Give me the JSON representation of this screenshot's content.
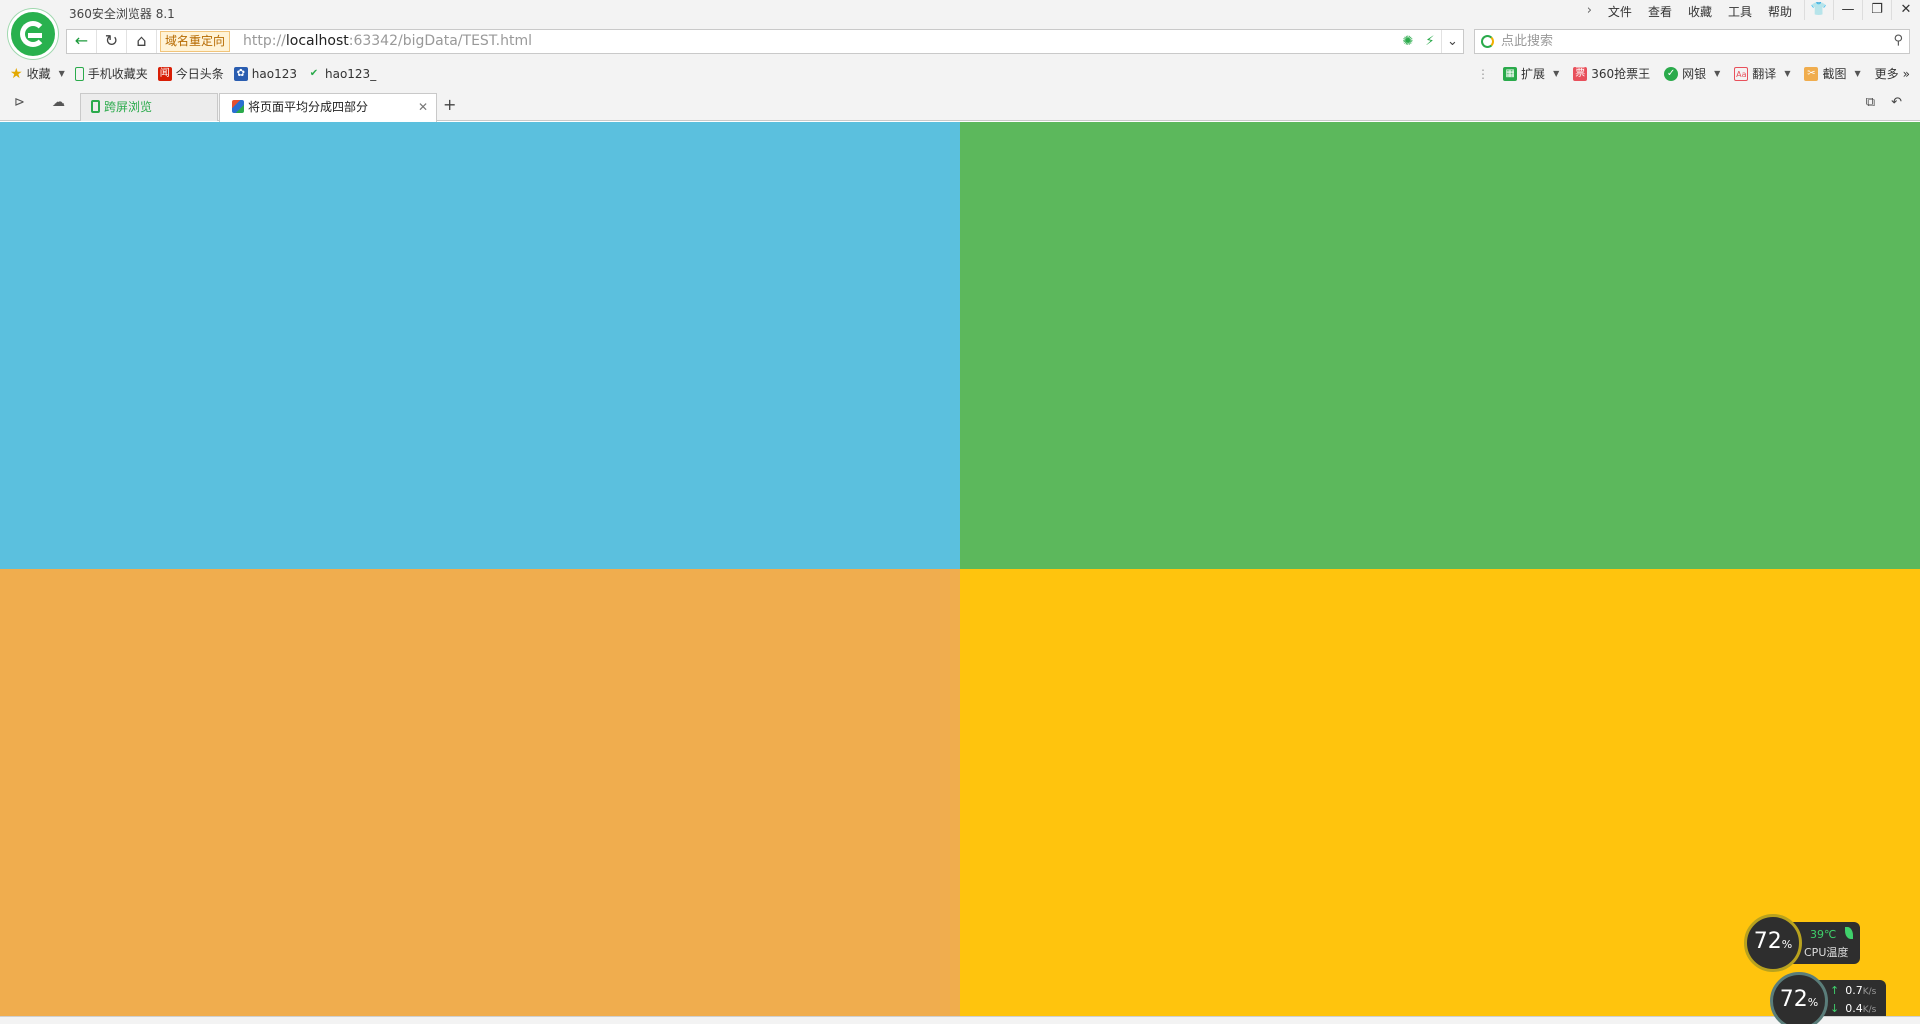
{
  "window": {
    "title": "360安全浏览器 8.1",
    "menu": [
      "文件",
      "查看",
      "收藏",
      "工具",
      "帮助"
    ]
  },
  "address_bar": {
    "redirect_badge": "域名重定向",
    "url_scheme": "http://",
    "url_host": "localhost",
    "url_rest": ":63342/bigData/TEST.html",
    "search_placeholder": "点此搜索"
  },
  "bookmarks": {
    "left": [
      {
        "label": "收藏",
        "icon": "star-icon"
      },
      {
        "label": "手机收藏夹",
        "icon": "phone-icon"
      },
      {
        "label": "今日头条",
        "icon": "news-icon",
        "icon_text": "闻"
      },
      {
        "label": "hao123",
        "icon": "paw-icon"
      },
      {
        "label": "hao123_",
        "icon": "hao-icon"
      }
    ],
    "right": [
      {
        "label": "扩展",
        "icon": "extension-icon"
      },
      {
        "label": "360抢票王",
        "icon": "ticket-icon"
      },
      {
        "label": "网银",
        "icon": "shield-icon"
      },
      {
        "label": "翻译",
        "icon": "translate-icon"
      },
      {
        "label": "截图",
        "icon": "screenshot-icon"
      },
      {
        "label": "更多",
        "icon": "more-icon"
      }
    ]
  },
  "tabs": [
    {
      "label": "跨屏浏览",
      "active": false
    },
    {
      "label": "将页面平均分成四部分",
      "active": true
    }
  ],
  "quadrants": {
    "top_left": "#5bc0de",
    "top_right": "#5cb85c",
    "bottom_left": "#f0ad4e",
    "bottom_right": "#ffc40d"
  },
  "cpu_widget": {
    "usage_value": "72",
    "usage_unit": "%",
    "temperature": "39℃",
    "label": "CPU温度"
  },
  "net_widget": {
    "usage_value": "72",
    "usage_unit": "%",
    "upload_value": "0.7",
    "download_value": "0.4",
    "speed_unit": "K/s"
  }
}
